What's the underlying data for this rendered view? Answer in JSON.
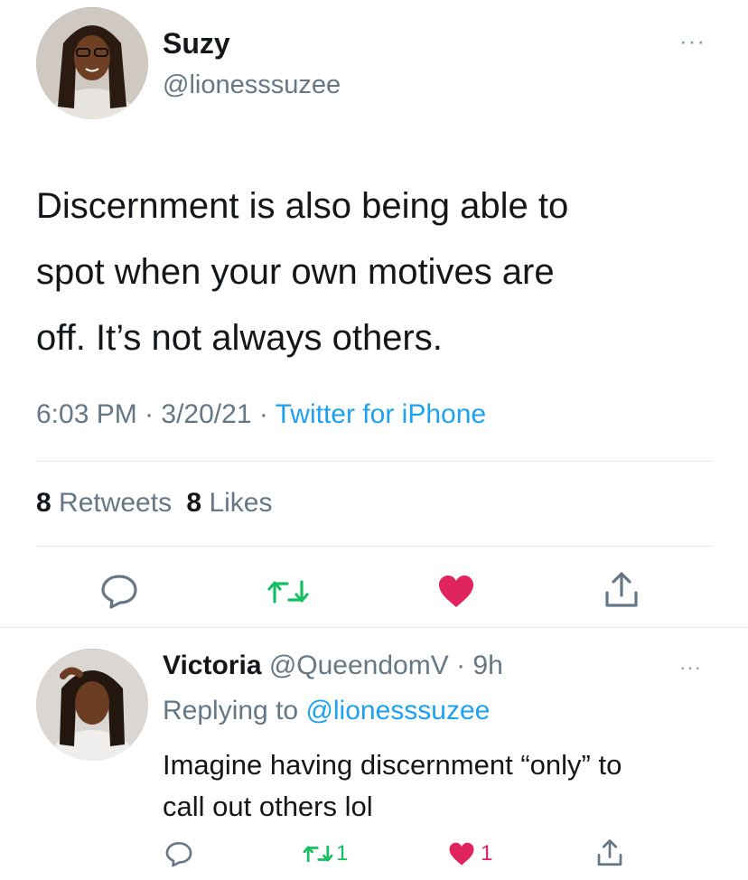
{
  "tweet": {
    "author_name": "Suzy",
    "author_handle": "@lionesssuzee",
    "text_line1": "Discernment is also being able to",
    "text_line2": "spot when your own motives are",
    "text_line3": "off. It’s not always others.",
    "time": "6:03 PM",
    "sep1": " · ",
    "date": "3/20/21",
    "sep2": " · ",
    "source": "Twitter for iPhone",
    "retweets_count": "8",
    "retweets_label": " Retweets",
    "likes_count": "8",
    "likes_label": " Likes",
    "more_glyph": "···"
  },
  "reply": {
    "author_name": "Victoria",
    "author_handle": " @QueendomV",
    "sep": " · ",
    "age": "9h",
    "replying_prefix": "Replying to ",
    "replying_handle": "@lionesssuzee",
    "text_line1": "Imagine having discernment “only” to",
    "text_line2": "call out others lol",
    "retweet_count": "1",
    "like_count": "1",
    "more_glyph": "···"
  },
  "colors": {
    "retweet_green": "#17bf63",
    "like_red": "#e0245e",
    "icon_gray": "#657786",
    "link_blue": "#1da1f2"
  }
}
